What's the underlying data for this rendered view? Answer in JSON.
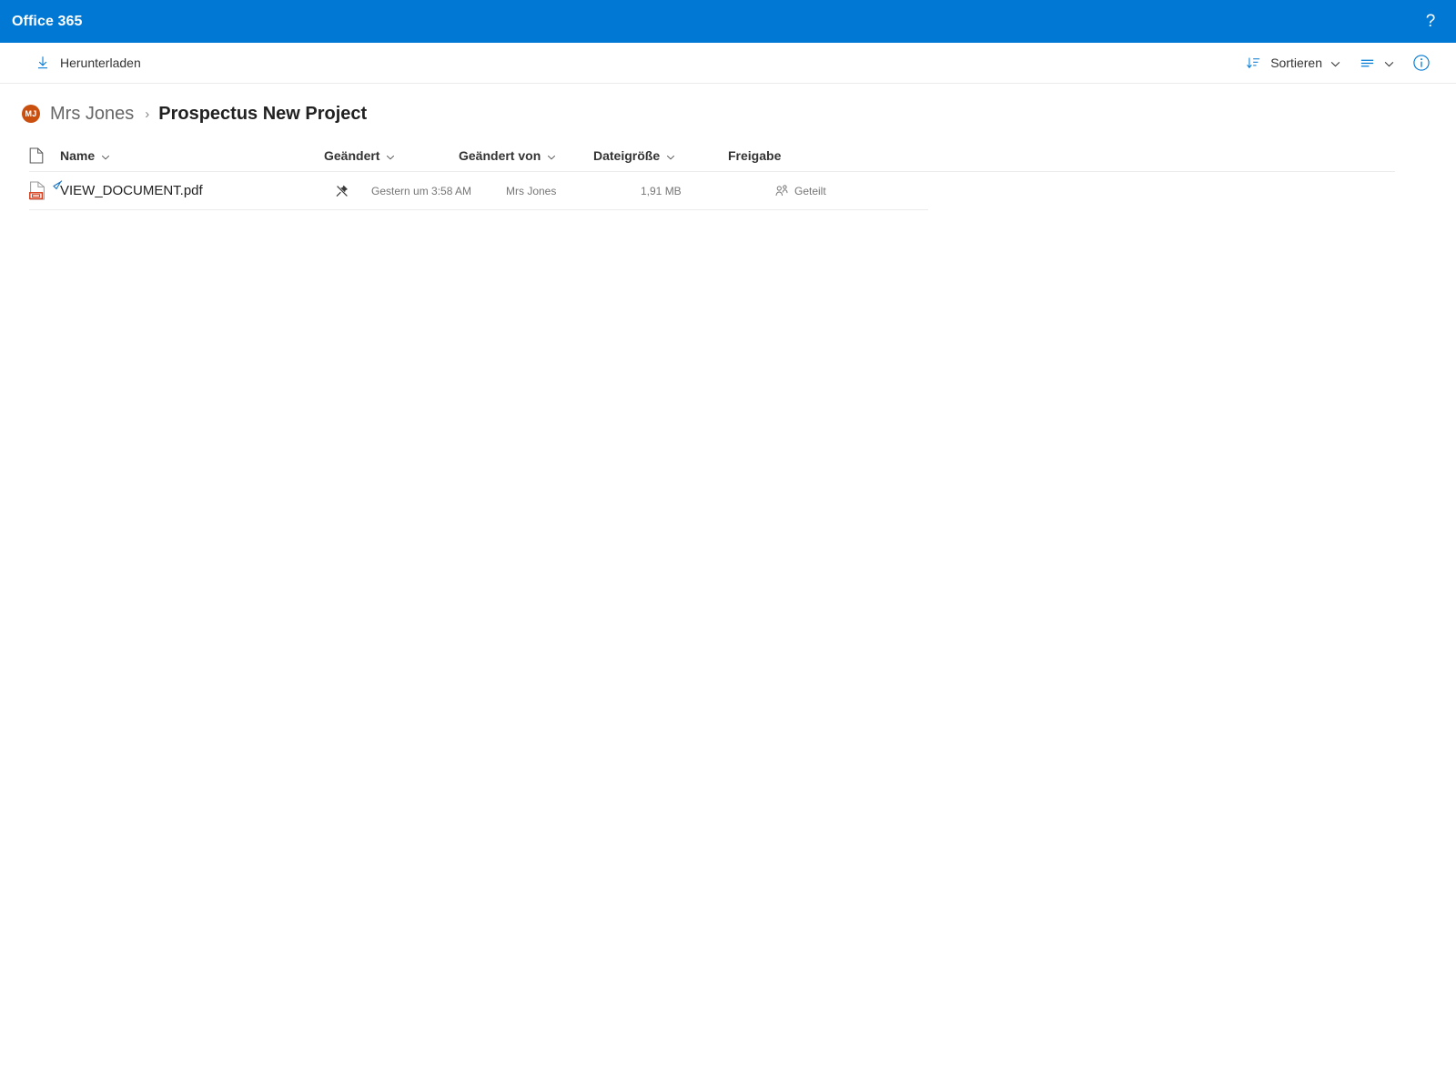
{
  "suite": {
    "title": "Office 365",
    "help_icon": "help-question-icon",
    "help_label": "?",
    "brand_color": "#0078d4"
  },
  "command_bar": {
    "download": {
      "label": "Herunterladen",
      "icon": "download-icon"
    },
    "sort": {
      "label": "Sortieren",
      "icon": "sort-descending-icon",
      "chevron": "ˇ"
    },
    "view": {
      "icon": "list-view-icon",
      "chevron": "ˇ"
    },
    "info": {
      "icon": "info-circle-icon"
    }
  },
  "breadcrumb": {
    "avatar_initials": "MJ",
    "avatar_color": "#ca5010",
    "root": "Mrs Jones",
    "separator": "›",
    "current": "Prospectus New Project"
  },
  "file_list": {
    "columns": [
      {
        "key": "icon",
        "label": "",
        "icon": "file-type-icon",
        "sortable": false
      },
      {
        "key": "name",
        "label": "Name",
        "sortable": true
      },
      {
        "key": "modified",
        "label": "Geändert",
        "sortable": true
      },
      {
        "key": "modified_by",
        "label": "Geändert von",
        "sortable": true
      },
      {
        "key": "size",
        "label": "Dateigröße",
        "sortable": true
      },
      {
        "key": "sharing",
        "label": "Freigabe",
        "sortable": false
      }
    ],
    "chevron": "ˇ",
    "rows": [
      {
        "file_icon": "pdf-file-icon",
        "name": "VIEW_DOCUMENT.pdf",
        "pin_icon": "unpin-icon",
        "modified": "Gestern um 3:58 AM",
        "modified_by": "Mrs Jones",
        "size": "1,91 MB",
        "sharing_icon": "people-shared-icon",
        "sharing": "Geteilt"
      }
    ]
  }
}
